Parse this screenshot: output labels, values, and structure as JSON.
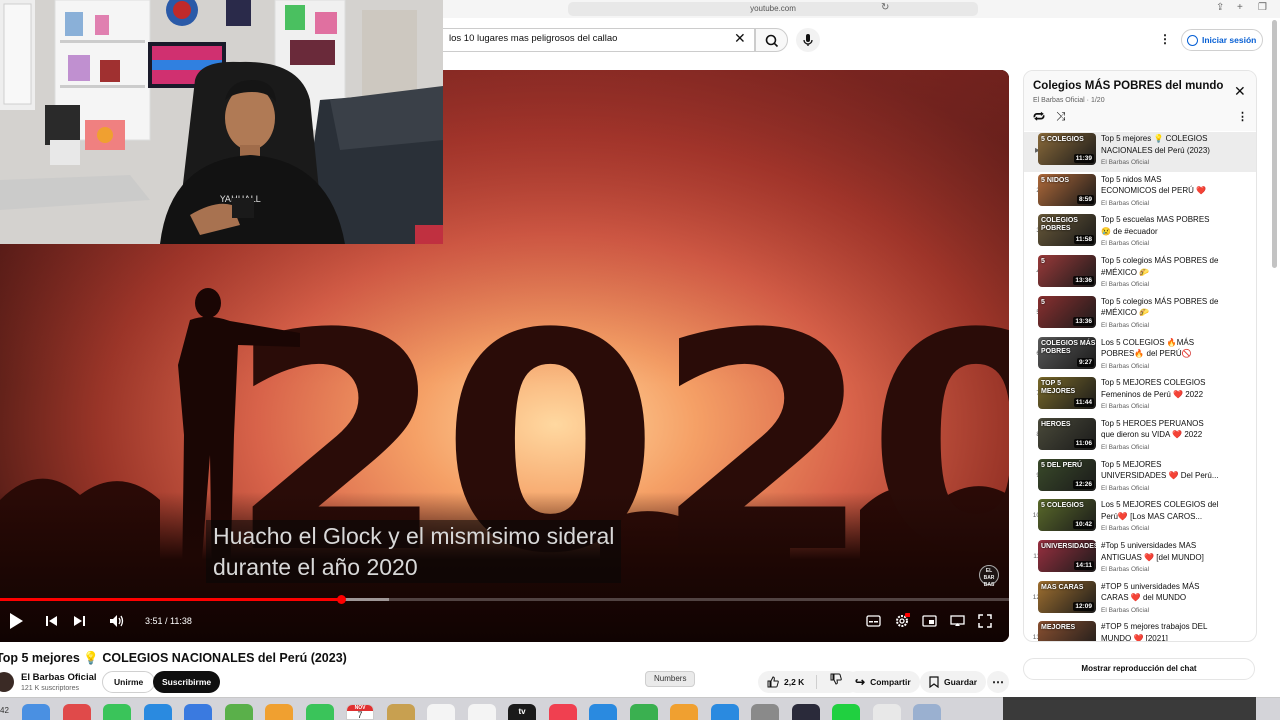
{
  "browser": {
    "url": "youtube.com"
  },
  "header": {
    "search_value": "los 10 lugares mas  peligrosos del callao",
    "signin_label": "Iniciar sesión"
  },
  "player": {
    "caption_line1": "Huacho el Glock y el mismísimo sideral",
    "caption_line2": "durante el año 2020",
    "backdrop_text": "2020",
    "watermark": "EL BAR BAS",
    "time_current": "3:51",
    "time_total": "11:38",
    "time_display": "3:51 / 11:38",
    "played_fraction": 0.338,
    "buffered_fraction": 0.386
  },
  "video": {
    "title": "Top 5 mejores 💡 COLEGIOS NACIONALES del Perú (2023)",
    "channel_name": "El Barbas Oficial",
    "subscribers": "121 K suscriptores",
    "join_label": "Unirme",
    "subscribe_label": "Suscribirme",
    "like_count": "2,2 K",
    "share_label": "Compartir",
    "save_label": "Guardar"
  },
  "tooltip": {
    "text": "Numbers"
  },
  "playlist": {
    "title": "Colegios MÁS POBRES del mundo",
    "subtitle": "El Barbas Oficial · 1/20",
    "show_chat_label": "Mostrar reproducción del chat",
    "items": [
      {
        "index": "▶",
        "title": "Top 5 mejores 💡 COLEGIOS NACIONALES del Perú (2023)",
        "channel": "El Barbas Oficial",
        "duration": "11:39",
        "thumb_text": "5 COLEGIOS",
        "color": "#8a6a3a"
      },
      {
        "index": "2",
        "title": "Top 5 nidos MAS ECONOMICOS del PERÚ ❤️",
        "channel": "El Barbas Oficial",
        "duration": "8:59",
        "thumb_text": "5 NIDOS",
        "color": "#b06a3a"
      },
      {
        "index": "3",
        "title": "Top 5 escuelas MAS POBRES 😢 de #ecuador",
        "channel": "El Barbas Oficial",
        "duration": "11:58",
        "thumb_text": "COLEGIOS POBRES",
        "color": "#6a5a3a"
      },
      {
        "index": "4",
        "title": "Top 5 colegios MÁS POBRES de #MÉXICO 🌮",
        "channel": "El Barbas Oficial",
        "duration": "13:36",
        "thumb_text": "5",
        "color": "#9a3a3a"
      },
      {
        "index": "5",
        "title": "Top 5 colegios MÁS POBRES de #MÉXICO 🌮",
        "channel": "El Barbas Oficial",
        "duration": "13:36",
        "thumb_text": "5",
        "color": "#8a3030"
      },
      {
        "index": "6",
        "title": "Los 5 COLEGIOS 🔥MÁS POBRES🔥 del PERÚ🚫",
        "channel": "El Barbas Oficial",
        "duration": "9:27",
        "thumb_text": "COLEGIOS MÁS POBRES",
        "color": "#5a5a5a"
      },
      {
        "index": "7",
        "title": "Top 5 MEJORES COLEGIOS Femeninos de Perú ❤️ 2022",
        "channel": "El Barbas Oficial",
        "duration": "11:44",
        "thumb_text": "TOP 5 MEJORES",
        "color": "#7a6a2a"
      },
      {
        "index": "8",
        "title": "Top 5 HEROES PERUANOS que dieron su VIDA ❤️ 2022",
        "channel": "El Barbas Oficial",
        "duration": "11:06",
        "thumb_text": "HEROES",
        "color": "#4a4a3a"
      },
      {
        "index": "9",
        "title": "Top 5 MEJORES UNIVERSIDADES ❤️ Del Perú...",
        "channel": "El Barbas Oficial",
        "duration": "12:26",
        "thumb_text": "5 DEL PERÚ",
        "color": "#3a4a2a"
      },
      {
        "index": "10",
        "title": "Los 5 MEJORES COLEGIOS del Perú❤️ [Los MAS CAROS...",
        "channel": "El Barbas Oficial",
        "duration": "10:42",
        "thumb_text": "5 COLEGIOS",
        "color": "#5a6a2a"
      },
      {
        "index": "11",
        "title": "#Top 5 universidades MAS ANTIGUAS ❤️ [del MUNDO]",
        "channel": "El Barbas Oficial",
        "duration": "14:11",
        "thumb_text": "UNIVERSIDADES",
        "color": "#9a3040"
      },
      {
        "index": "12",
        "title": "#TOP 5 universidades MÁS CARAS ❤️ del MUNDO [PERU...",
        "channel": "El Barbas Oficial",
        "duration": "12:09",
        "thumb_text": "MAS CARAS",
        "color": "#a07030"
      },
      {
        "index": "13",
        "title": "#TOP 5 mejores trabajos DEL MUNDO ❤️ [2021]",
        "channel": "El Barbas Oficial",
        "duration": "",
        "thumb_text": "MEJORES",
        "color": "#8a5030"
      }
    ]
  },
  "dock": {
    "left_text": "42",
    "calendar_month": "NOV",
    "calendar_day": "7",
    "tv_label": "tv",
    "icons": [
      {
        "name": "finder-icon",
        "color": "#4a90e2"
      },
      {
        "name": "launchpad-icon",
        "color": "#e04a4a"
      },
      {
        "name": "messages-icon",
        "color": "#3ac45a"
      },
      {
        "name": "safari-icon",
        "color": "#2a8ae0"
      },
      {
        "name": "mail-icon",
        "color": "#3a7ae0"
      },
      {
        "name": "maps-icon",
        "color": "#5ab04a"
      },
      {
        "name": "photos-icon",
        "color": "#f0a030"
      },
      {
        "name": "facetime-icon",
        "color": "#3ac45a"
      },
      {
        "name": "calendar-icon",
        "color": "#ffffff"
      },
      {
        "name": "notes-icon",
        "color": "#c8a050"
      },
      {
        "name": "reminders-icon",
        "color": "#f4f4f4"
      },
      {
        "name": "freeform-icon",
        "color": "#f4f4f4"
      },
      {
        "name": "tv-icon",
        "color": "#1a1a1a"
      },
      {
        "name": "music-icon",
        "color": "#f04050"
      },
      {
        "name": "keynote-icon",
        "color": "#2a8ae0"
      },
      {
        "name": "numbers-icon",
        "color": "#3ab050"
      },
      {
        "name": "pages-icon",
        "color": "#f0a030"
      },
      {
        "name": "appstore-icon",
        "color": "#2a8ae0"
      },
      {
        "name": "settings-icon",
        "color": "#8a8a8a"
      },
      {
        "name": "obs-icon",
        "color": "#2a2a3a"
      },
      {
        "name": "kick-icon",
        "color": "#20d040"
      },
      {
        "name": "preview-icon",
        "color": "#e8e8e8"
      },
      {
        "name": "files-icon",
        "color": "#9ab0d0"
      }
    ]
  },
  "colors": {
    "accent": "#ff0000",
    "link": "#065fd4",
    "bg": "#ffffff"
  }
}
